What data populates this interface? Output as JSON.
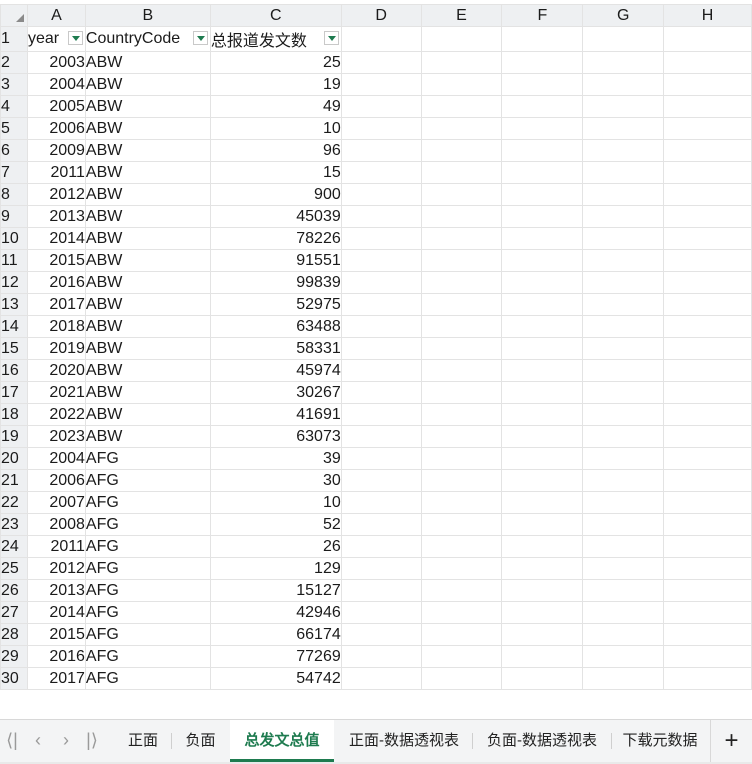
{
  "sheet": {
    "columns": [
      "A",
      "B",
      "C",
      "D",
      "E",
      "F",
      "G",
      "H"
    ],
    "header_row": {
      "row_number": "1",
      "year": "year",
      "country": "CountryCode",
      "total": "总报道发文数"
    },
    "rows": [
      {
        "n": "2",
        "year": "2003",
        "code": "ABW",
        "total": "25"
      },
      {
        "n": "3",
        "year": "2004",
        "code": "ABW",
        "total": "19"
      },
      {
        "n": "4",
        "year": "2005",
        "code": "ABW",
        "total": "49"
      },
      {
        "n": "5",
        "year": "2006",
        "code": "ABW",
        "total": "10"
      },
      {
        "n": "6",
        "year": "2009",
        "code": "ABW",
        "total": "96"
      },
      {
        "n": "7",
        "year": "2011",
        "code": "ABW",
        "total": "15"
      },
      {
        "n": "8",
        "year": "2012",
        "code": "ABW",
        "total": "900"
      },
      {
        "n": "9",
        "year": "2013",
        "code": "ABW",
        "total": "45039"
      },
      {
        "n": "10",
        "year": "2014",
        "code": "ABW",
        "total": "78226"
      },
      {
        "n": "11",
        "year": "2015",
        "code": "ABW",
        "total": "91551"
      },
      {
        "n": "12",
        "year": "2016",
        "code": "ABW",
        "total": "99839"
      },
      {
        "n": "13",
        "year": "2017",
        "code": "ABW",
        "total": "52975"
      },
      {
        "n": "14",
        "year": "2018",
        "code": "ABW",
        "total": "63488"
      },
      {
        "n": "15",
        "year": "2019",
        "code": "ABW",
        "total": "58331"
      },
      {
        "n": "16",
        "year": "2020",
        "code": "ABW",
        "total": "45974"
      },
      {
        "n": "17",
        "year": "2021",
        "code": "ABW",
        "total": "30267"
      },
      {
        "n": "18",
        "year": "2022",
        "code": "ABW",
        "total": "41691"
      },
      {
        "n": "19",
        "year": "2023",
        "code": "ABW",
        "total": "63073"
      },
      {
        "n": "20",
        "year": "2004",
        "code": "AFG",
        "total": "39"
      },
      {
        "n": "21",
        "year": "2006",
        "code": "AFG",
        "total": "30"
      },
      {
        "n": "22",
        "year": "2007",
        "code": "AFG",
        "total": "10"
      },
      {
        "n": "23",
        "year": "2008",
        "code": "AFG",
        "total": "52"
      },
      {
        "n": "24",
        "year": "2011",
        "code": "AFG",
        "total": "26"
      },
      {
        "n": "25",
        "year": "2012",
        "code": "AFG",
        "total": "129"
      },
      {
        "n": "26",
        "year": "2013",
        "code": "AFG",
        "total": "15127"
      },
      {
        "n": "27",
        "year": "2014",
        "code": "AFG",
        "total": "42946"
      },
      {
        "n": "28",
        "year": "2015",
        "code": "AFG",
        "total": "66174"
      },
      {
        "n": "29",
        "year": "2016",
        "code": "AFG",
        "total": "77269"
      },
      {
        "n": "30",
        "year": "2017",
        "code": "AFG",
        "total": "54742"
      }
    ]
  },
  "tabs": {
    "items": [
      {
        "label": "正面"
      },
      {
        "label": "负面"
      },
      {
        "label": "总发文总值"
      },
      {
        "label": "正面-数据透视表"
      },
      {
        "label": "负面-数据透视表"
      },
      {
        "label": "下载元数据"
      }
    ],
    "active_index": 2,
    "nav_icons": [
      "first-sheet-icon",
      "prev-sheet-icon",
      "next-sheet-icon",
      "last-sheet-icon"
    ],
    "add_symbol": "+"
  },
  "colors": {
    "accent": "#1e7b4f",
    "header_bg": "#eef0f2",
    "gridline": "#e3e3e3"
  }
}
